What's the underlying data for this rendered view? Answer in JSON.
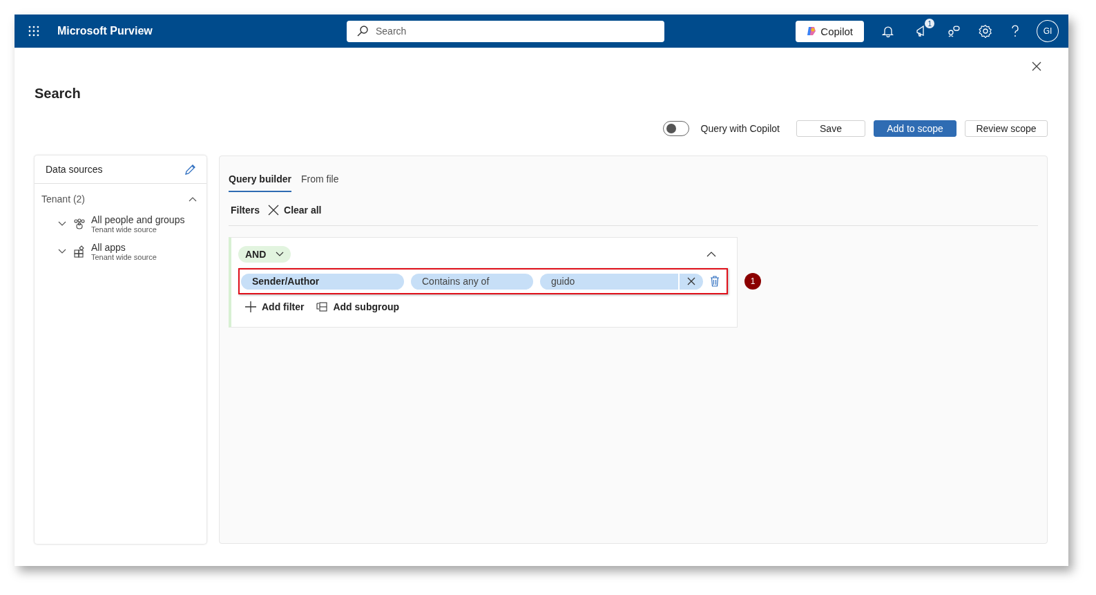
{
  "app": {
    "title": "Microsoft Purview"
  },
  "search": {
    "placeholder": "Search"
  },
  "copilot_button": "Copilot",
  "notifications_badge": "1",
  "avatar": "GI",
  "page_title": "Search",
  "toolbar": {
    "toggle": {
      "label": "Query with Copilot",
      "on": false
    },
    "buttons": [
      {
        "label": "Save",
        "kind": "default"
      },
      {
        "label": "Add to scope",
        "kind": "primary"
      },
      {
        "label": "Review scope",
        "kind": "default"
      }
    ]
  },
  "data_sources": {
    "title": "Data sources",
    "group": {
      "label": "Tenant (2)",
      "expanded": true,
      "items": [
        {
          "name": "All people and groups",
          "subtitle": "Tenant wide source",
          "kind": "people",
          "expanded": false
        },
        {
          "name": "All apps",
          "subtitle": "Tenant wide source",
          "kind": "apps",
          "expanded": false
        }
      ]
    }
  },
  "tabs": [
    {
      "label": "Query builder",
      "selected": true
    },
    {
      "label": "From file",
      "selected": false
    }
  ],
  "filters": {
    "label": "Filters",
    "clear": "Clear all"
  },
  "group": {
    "operator": "AND",
    "expanded": true,
    "conditions": [
      {
        "field": "Sender/Author",
        "operator": "Contains any of",
        "value": "guido",
        "highlighted": true,
        "callout": "1"
      }
    ],
    "actions": [
      {
        "label": "Add filter",
        "kind": "add"
      },
      {
        "label": "Add subgroup",
        "kind": "subgroup"
      }
    ]
  }
}
